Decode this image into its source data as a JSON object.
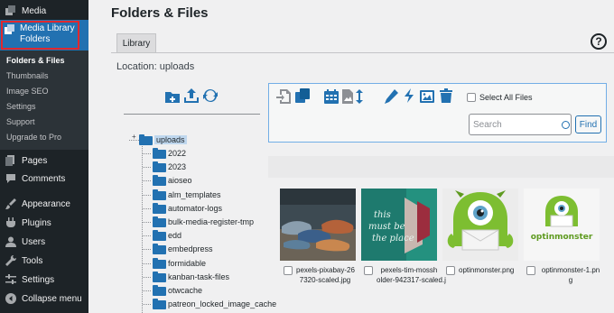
{
  "sidebar": {
    "media": "Media",
    "media_library_folders": "Media Library Folders",
    "submenu": [
      "Folders & Files",
      "Thumbnails",
      "Image SEO",
      "Settings",
      "Support",
      "Upgrade to Pro"
    ],
    "pages": "Pages",
    "comments": "Comments",
    "appearance": "Appearance",
    "plugins": "Plugins",
    "users": "Users",
    "tools": "Tools",
    "settings": "Settings",
    "collapse": "Collapse menu"
  },
  "main": {
    "title": "Folders & Files",
    "tab_label": "Library",
    "help": "?",
    "location": "Location: uploads"
  },
  "toolbar": {
    "select_all_label": "Select All Files",
    "search_placeholder": "Search",
    "find_label": "Find"
  },
  "tree": {
    "root": "uploads",
    "children": [
      "2022",
      "2023",
      "aioseo",
      "alm_templates",
      "automator-logs",
      "bulk-media-register-tmp",
      "edd",
      "embedpress",
      "formidable",
      "kanban-task-files",
      "otwcache",
      "patreon_locked_image_cache"
    ]
  },
  "media": {
    "items": [
      {
        "filename": "pexels-pixabay-26\n7320-scaled.jpg"
      },
      {
        "filename": "pexels-tim-mossh\nolder-942317-scaled.j"
      },
      {
        "filename": "optinmonster.png"
      },
      {
        "filename": "optinmonster-1.pn\ng"
      }
    ],
    "thumb_text": {
      "sign_line1": "this",
      "sign_line2": "must be",
      "sign_line3": "the place",
      "logo": "optinmonster"
    }
  },
  "colors": {
    "sidebar_bg": "#1d2327",
    "accent": "#2271b1",
    "highlight_outline": "#e0282e"
  }
}
